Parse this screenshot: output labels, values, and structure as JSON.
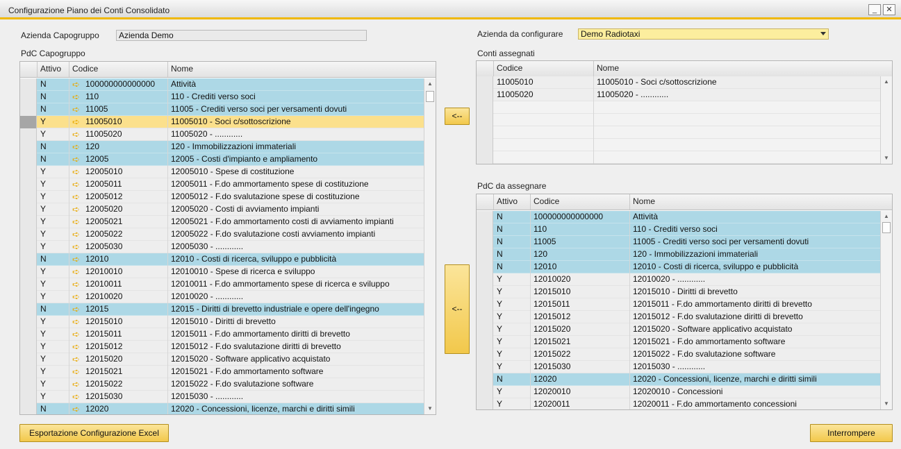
{
  "window": {
    "title": "Configurazione Piano dei Conti Consolidato"
  },
  "header": {
    "capogruppo_label": "Azienda Capogruppo",
    "capogruppo_value": "Azienda Demo",
    "configurare_label": "Azienda da configurare",
    "configurare_value": "Demo Radiotaxi"
  },
  "pdc_capogruppo": {
    "label": "PdC Capogruppo",
    "columns": [
      "Attivo",
      "Codice",
      "Nome"
    ],
    "rows": [
      {
        "attivo": "N",
        "codice": "100000000000000",
        "nome": "Attività"
      },
      {
        "attivo": "N",
        "codice": "110",
        "nome": "110 - Crediti verso soci"
      },
      {
        "attivo": "N",
        "codice": "11005",
        "nome": "11005 - Crediti verso soci per versamenti dovuti"
      },
      {
        "attivo": "Y",
        "codice": "11005010",
        "nome": "11005010 - Soci c/sottoscrizione",
        "selected": true
      },
      {
        "attivo": "Y",
        "codice": "11005020",
        "nome": "11005020 - ............"
      },
      {
        "attivo": "N",
        "codice": "120",
        "nome": "120 - Immobilizzazioni immateriali"
      },
      {
        "attivo": "N",
        "codice": "12005",
        "nome": "12005 - Costi d'impianto e ampliamento"
      },
      {
        "attivo": "Y",
        "codice": "12005010",
        "nome": "12005010 - Spese di costituzione"
      },
      {
        "attivo": "Y",
        "codice": "12005011",
        "nome": "12005011 - F.do ammortamento spese di costituzione"
      },
      {
        "attivo": "Y",
        "codice": "12005012",
        "nome": "12005012 - F.do svalutazione spese di costituzione"
      },
      {
        "attivo": "Y",
        "codice": "12005020",
        "nome": "12005020 - Costi di avviamento impianti"
      },
      {
        "attivo": "Y",
        "codice": "12005021",
        "nome": "12005021 - F.do ammortamento costi di avviamento impianti"
      },
      {
        "attivo": "Y",
        "codice": "12005022",
        "nome": "12005022 - F.do svalutazione costi avviamento impianti"
      },
      {
        "attivo": "Y",
        "codice": "12005030",
        "nome": "12005030 - ............"
      },
      {
        "attivo": "N",
        "codice": "12010",
        "nome": "12010 - Costi di ricerca, sviluppo e pubblicità"
      },
      {
        "attivo": "Y",
        "codice": "12010010",
        "nome": "12010010 - Spese di ricerca e sviluppo"
      },
      {
        "attivo": "Y",
        "codice": "12010011",
        "nome": "12010011 - F.do ammortamento spese di ricerca e sviluppo"
      },
      {
        "attivo": "Y",
        "codice": "12010020",
        "nome": "12010020 - ............"
      },
      {
        "attivo": "N",
        "codice": "12015",
        "nome": "12015 - Diritti di brevetto industriale e opere dell'ingegno"
      },
      {
        "attivo": "Y",
        "codice": "12015010",
        "nome": "12015010 - Diritti di brevetto"
      },
      {
        "attivo": "Y",
        "codice": "12015011",
        "nome": "12015011 - F.do ammortamento diritti di brevetto"
      },
      {
        "attivo": "Y",
        "codice": "12015012",
        "nome": "12015012 - F.do svalutazione diritti di brevetto"
      },
      {
        "attivo": "Y",
        "codice": "12015020",
        "nome": "12015020 - Software applicativo acquistato"
      },
      {
        "attivo": "Y",
        "codice": "12015021",
        "nome": "12015021 - F.do ammortamento software"
      },
      {
        "attivo": "Y",
        "codice": "12015022",
        "nome": "12015022 - F.do svalutazione software"
      },
      {
        "attivo": "Y",
        "codice": "12015030",
        "nome": "12015030 - ............"
      },
      {
        "attivo": "N",
        "codice": "12020",
        "nome": "12020 - Concessioni, licenze, marchi e diritti simili"
      }
    ]
  },
  "conti_assegnati": {
    "label": "Conti assegnati",
    "columns": [
      "Codice",
      "Nome"
    ],
    "rows": [
      {
        "codice": "11005010",
        "nome": "11005010 - Soci c/sottoscrizione"
      },
      {
        "codice": "11005020",
        "nome": "11005020 - ............"
      }
    ],
    "empty_rows": 5
  },
  "pdc_da_assegnare": {
    "label": "PdC da assegnare",
    "columns": [
      "Attivo",
      "Codice",
      "Nome"
    ],
    "rows": [
      {
        "attivo": "N",
        "codice": "100000000000000",
        "nome": "Attività"
      },
      {
        "attivo": "N",
        "codice": "110",
        "nome": "110 - Crediti verso soci"
      },
      {
        "attivo": "N",
        "codice": "11005",
        "nome": "11005 - Crediti verso soci per versamenti dovuti"
      },
      {
        "attivo": "N",
        "codice": "120",
        "nome": "120 - Immobilizzazioni immateriali"
      },
      {
        "attivo": "N",
        "codice": "12010",
        "nome": "12010 - Costi di ricerca, sviluppo e pubblicità"
      },
      {
        "attivo": "Y",
        "codice": "12010020",
        "nome": "12010020 - ............"
      },
      {
        "attivo": "Y",
        "codice": "12015010",
        "nome": "12015010 - Diritti di brevetto"
      },
      {
        "attivo": "Y",
        "codice": "12015011",
        "nome": "12015011 - F.do ammortamento diritti di brevetto"
      },
      {
        "attivo": "Y",
        "codice": "12015012",
        "nome": "12015012 - F.do svalutazione diritti di brevetto"
      },
      {
        "attivo": "Y",
        "codice": "12015020",
        "nome": "12015020 - Software applicativo acquistato"
      },
      {
        "attivo": "Y",
        "codice": "12015021",
        "nome": "12015021 - F.do ammortamento software"
      },
      {
        "attivo": "Y",
        "codice": "12015022",
        "nome": "12015022 - F.do svalutazione software"
      },
      {
        "attivo": "Y",
        "codice": "12015030",
        "nome": "12015030 - ............"
      },
      {
        "attivo": "N",
        "codice": "12020",
        "nome": "12020 - Concessioni, licenze, marchi e diritti simili"
      },
      {
        "attivo": "Y",
        "codice": "12020010",
        "nome": "12020010 - Concessioni"
      },
      {
        "attivo": "Y",
        "codice": "12020011",
        "nome": "12020011 - F.do ammortamento concessioni"
      }
    ]
  },
  "buttons": {
    "move_back_small": "<--",
    "move_back_large": "<--",
    "export_excel": "Esportazione Configurazione Excel",
    "cancel": "Interrompere"
  },
  "colors": {
    "active_n": "#add8e6",
    "selected": "#fbe08c",
    "accent": "#f0b800",
    "link_arrow": "#e9a800"
  }
}
